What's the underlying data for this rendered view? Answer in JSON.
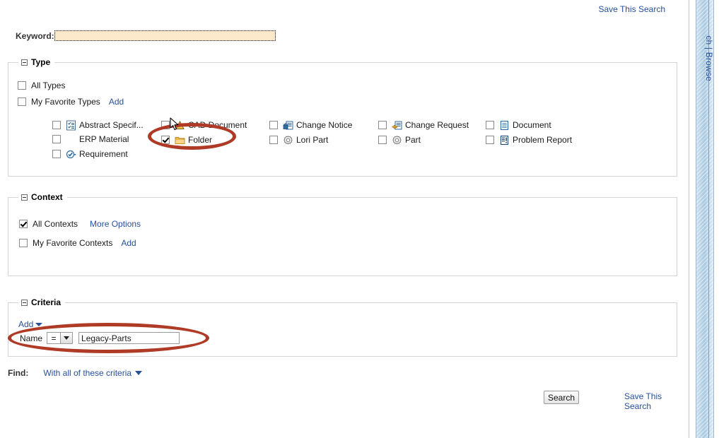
{
  "page": {
    "save_search_top": "Save This Search",
    "save_search_bottom": "Save This Search",
    "search_button": "Search"
  },
  "keyword": {
    "label": "Keyword:",
    "value": "",
    "placeholder": ""
  },
  "type_section": {
    "legend": "Type",
    "all_types": {
      "label": "All Types",
      "checked": false
    },
    "my_favorite_types": {
      "label": "My Favorite Types",
      "checked": false,
      "add_label": "Add"
    },
    "columns": [
      {
        "items": [
          {
            "label": "Abstract Specif...",
            "icon": "abstract-spec-icon",
            "checked": false
          },
          {
            "label": "ERP Material",
            "icon": "none",
            "checked": false
          },
          {
            "label": "Requirement",
            "icon": "requirement-icon",
            "checked": false
          }
        ]
      },
      {
        "items": [
          {
            "label": "CAD Document",
            "icon": "cad-document-icon",
            "checked": false
          },
          {
            "label": "Folder",
            "icon": "folder-icon",
            "checked": true
          }
        ]
      },
      {
        "items": [
          {
            "label": "Change Notice",
            "icon": "change-notice-icon",
            "checked": false
          },
          {
            "label": "Lori Part",
            "icon": "part-gear-icon",
            "checked": false
          }
        ]
      },
      {
        "items": [
          {
            "label": "Change Request",
            "icon": "change-request-icon",
            "checked": false
          },
          {
            "label": "Part",
            "icon": "part-gear-icon",
            "checked": false
          }
        ]
      },
      {
        "items": [
          {
            "label": "Document",
            "icon": "document-icon",
            "checked": false
          },
          {
            "label": "Problem Report",
            "icon": "problem-report-icon",
            "checked": false
          }
        ]
      }
    ]
  },
  "context_section": {
    "legend": "Context",
    "all_contexts": {
      "label": "All Contexts",
      "checked": true
    },
    "more_options_label": "More Options",
    "my_favorite_contexts": {
      "label": "My Favorite Contexts",
      "checked": false,
      "add_label": "Add"
    }
  },
  "criteria_section": {
    "legend": "Criteria",
    "add_label": "Add",
    "row": {
      "attribute": "Name",
      "operator": "=",
      "value": "Legacy-Parts"
    }
  },
  "find": {
    "label": "Find:",
    "value": "With all of these criteria"
  },
  "sidebar": {
    "label": "ch | Browse"
  },
  "colors": {
    "link": "#27509B",
    "annotation": "#AF3A25",
    "keyword_background": "#FCE8CA",
    "folder_icon": "#F0A830",
    "sidebar": "#A9C9E0"
  }
}
